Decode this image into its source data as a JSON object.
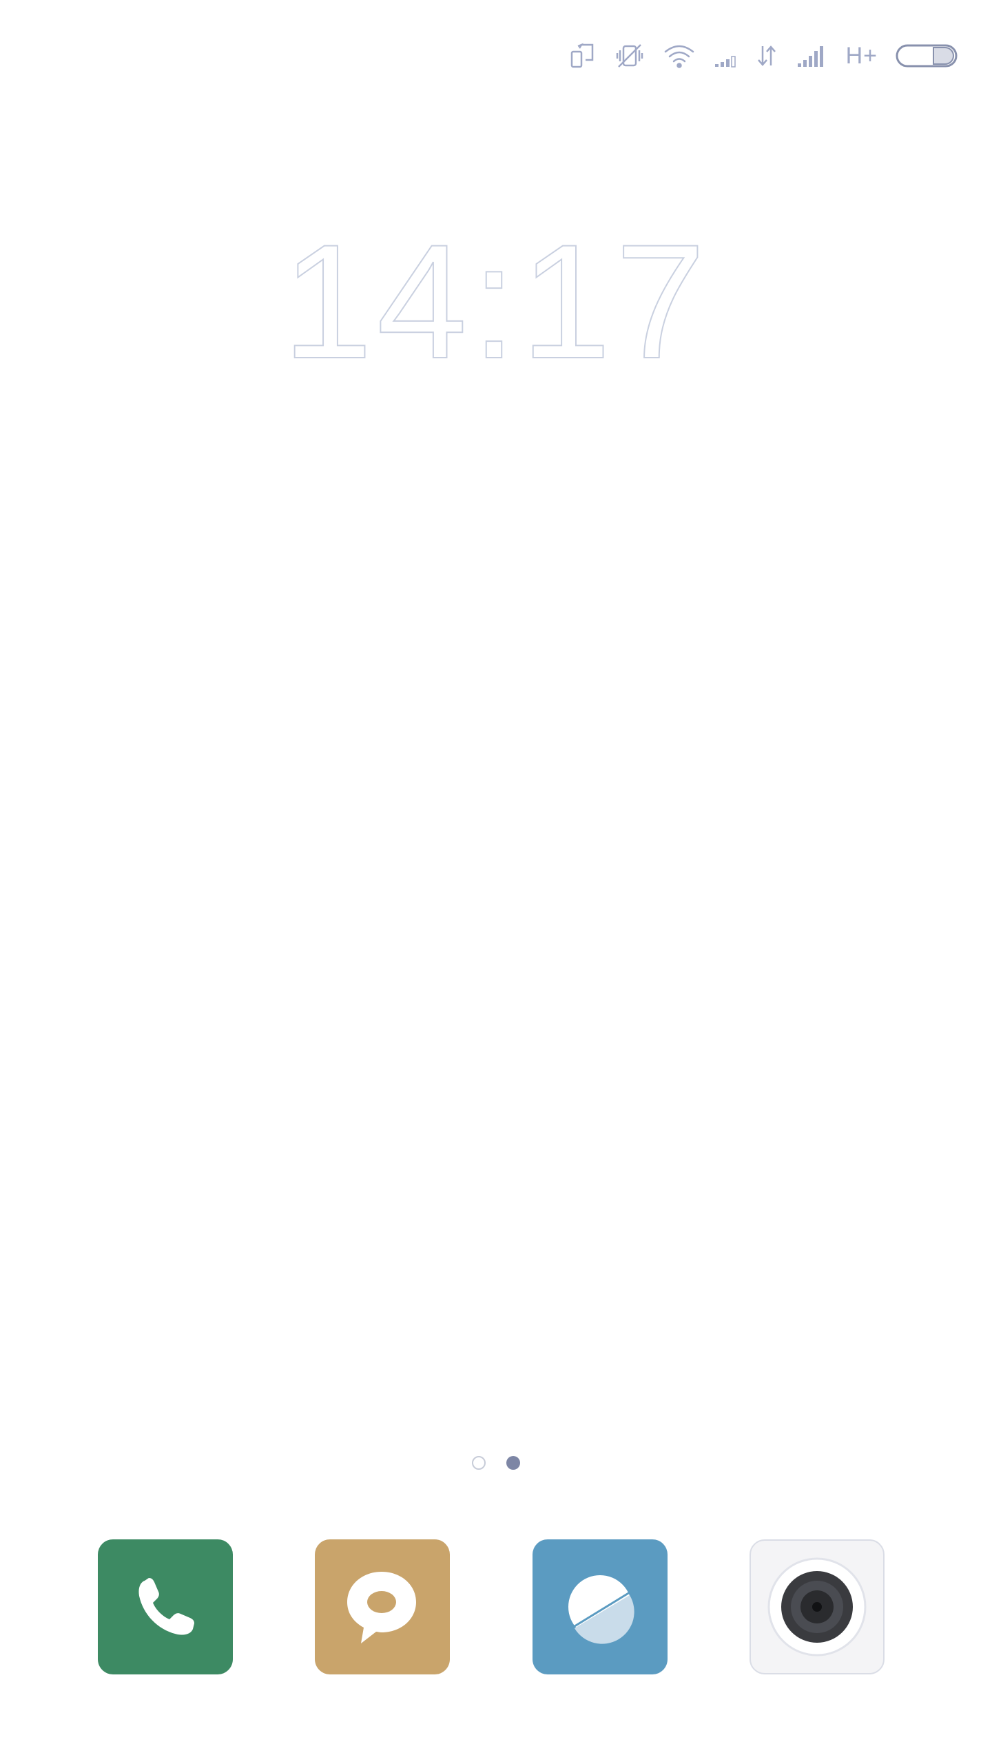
{
  "status_bar": {
    "icons": [
      "screen-rotation-icon",
      "vibrate-off-icon",
      "wifi-icon",
      "signal-weak-icon",
      "data-transfer-icon",
      "signal-full-icon",
      "battery-icon"
    ],
    "network_type": "H+",
    "colors": {
      "icon": "#9fa8c6"
    }
  },
  "clock": {
    "time": "14:17"
  },
  "page_indicator": {
    "pages": 2,
    "current_page": 2
  },
  "dock": {
    "apps": [
      {
        "icon": "phone-icon",
        "color": "#3d8a63"
      },
      {
        "icon": "messages-icon",
        "color": "#c9a46b"
      },
      {
        "icon": "browser-icon",
        "color": "#5b9bc1"
      },
      {
        "icon": "camera-icon",
        "color": "#f4f4f6"
      }
    ]
  }
}
